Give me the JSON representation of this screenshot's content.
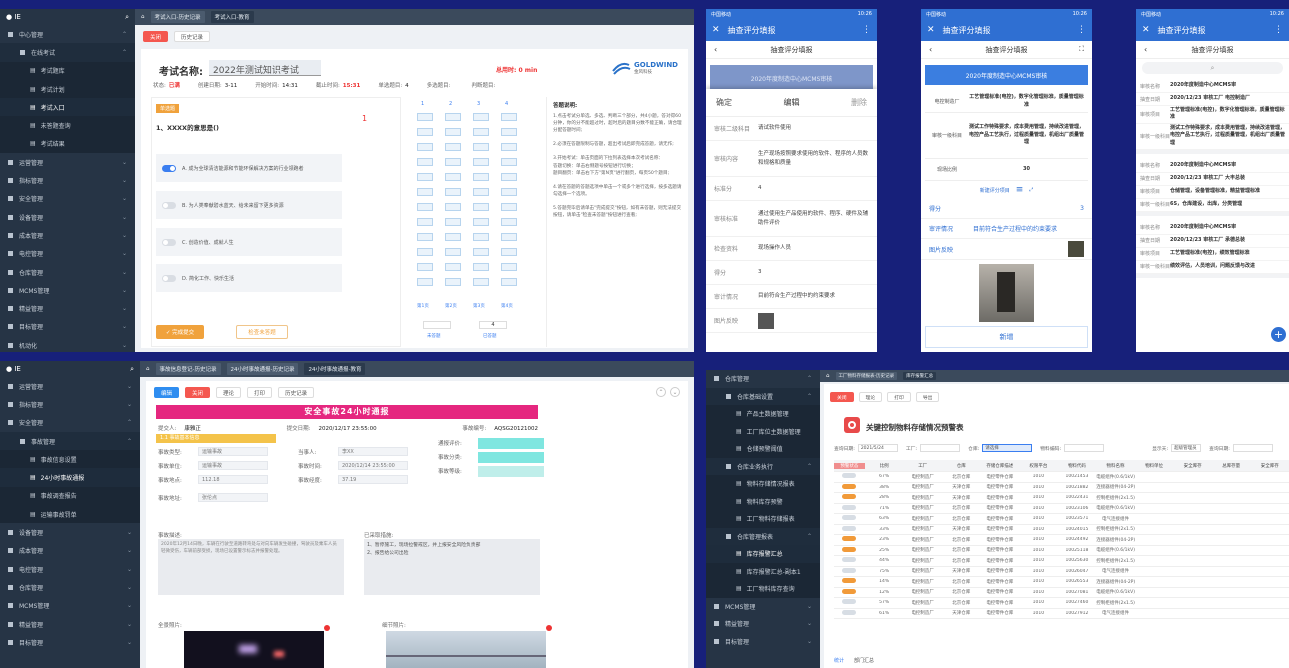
{
  "logo": "● IE",
  "p1": {
    "tabs": [
      "考试入口-历史记录",
      "考试入口-教育"
    ],
    "sidebar": [
      {
        "label": "中心管理",
        "level": 0,
        "open": true
      },
      {
        "label": "在线考试",
        "level": 1,
        "open": true
      },
      {
        "label": "考试题库",
        "level": 2
      },
      {
        "label": "考试计划",
        "level": 2
      },
      {
        "label": "考试入口",
        "level": 2,
        "active": true
      },
      {
        "label": "未答题查询",
        "level": 2
      },
      {
        "label": "考试结果",
        "level": 2
      },
      {
        "label": "运营管理",
        "level": 0
      },
      {
        "label": "指标管理",
        "level": 0
      },
      {
        "label": "安全管理",
        "level": 0
      },
      {
        "label": "设备管理",
        "level": 0
      },
      {
        "label": "成本管理",
        "level": 0
      },
      {
        "label": "电控管理",
        "level": 0
      },
      {
        "label": "仓库管理",
        "level": 0
      },
      {
        "label": "MCMS管理",
        "level": 0
      },
      {
        "label": "精益管理",
        "level": 0
      },
      {
        "label": "目标管理",
        "level": 0
      },
      {
        "label": "机动化",
        "level": 0
      }
    ],
    "buttons": {
      "close": "关闭",
      "history": "历史记录",
      "submit": "✓ 完成提交",
      "next": "检查未答题"
    },
    "exam_label": "考试名称:",
    "exam_name": "2022年测试知识考试",
    "timer_label": "总用时:",
    "timer_value": "0 min",
    "brand": "GOLDWIND",
    "brand_sub": "金风科技",
    "info": [
      {
        "k": "状态:",
        "v": "已满"
      },
      {
        "k": "创建日期:",
        "v": "3-11"
      },
      {
        "k": "开始时间:",
        "v": "14:31"
      },
      {
        "k": "截止时间:",
        "v": "15:31"
      },
      {
        "k": "单选题目:",
        "v": "4"
      },
      {
        "k": "多选题目:",
        "v": ""
      },
      {
        "k": "判断题目:",
        "v": ""
      }
    ],
    "qtag": "单选题",
    "question": "1、XXXX的意思是()",
    "score": "1",
    "options": [
      "A. 成为全球清洁能源和节能环保解决方案的行业领跑者",
      "B. 为人类奉献碧水蓝天、给未来留下更多资源",
      "C. 创造价值、成就人生",
      "D. 简化工作、快乐生活"
    ],
    "grid_cols": [
      "1",
      "2",
      "3",
      "4"
    ],
    "grid_pages": [
      "第1页",
      "第2页",
      "第3页",
      "第4页"
    ],
    "pager_labels": [
      "未答题",
      "已答题"
    ],
    "pager_value": "4",
    "notes_title": "答题说明:",
    "notes": [
      "1.点击考试分单选、多选、判断三个部分，共4小题，答对得60分钟，你的分不能超过时，超时后的题目分数不能正确，请合理分配答题时间;",
      "2.必须在答题限制与答题，超出考试后即完成答题，请无作;",
      "3.开始考试：单击页面的下拉列表选择本次考试名称：\n答题切换：单击右侧题号按钮进行切换；\n题目翻页：单击右下方\"第N页\"进行翻页，每页50个题目;",
      "4.请在答题的答题选项中单击一个或多个进行选择，按多选题请勾选择一个选项。",
      "5.答题完毕后请单击\"完成提交\"按钮，如有未答题，则无法提交按钮，请单击\"检查未答题\"按钮进行查看;"
    ]
  },
  "phone1": {
    "status": "中国移动",
    "status_right": "10:26",
    "title": "抽查评分填报",
    "subtitle": "抽查评分填报",
    "banner": "2020年度制造中心MCMS审核",
    "sheet_actions": [
      "确定",
      "编辑",
      "删除"
    ],
    "rows": [
      {
        "k": "审核二级科目",
        "v": "请试软件使用"
      },
      {
        "k": "审核内容",
        "v": "生产现场按照要求使用的软件、程序的人员数和规格和质量"
      },
      {
        "k": "标准分",
        "v": "4"
      },
      {
        "k": "审核标准",
        "v": "通过使用生产品使用的软件、程序、硬件及辅助件评价"
      },
      {
        "k": "检查资料",
        "v": "现场操作人员"
      },
      {
        "k": "得分",
        "v": "3"
      },
      {
        "k": "审计情况",
        "v": "目前符合生产过程中的约束要求"
      },
      {
        "k": "图片反映",
        "v": ""
      }
    ]
  },
  "phone2": {
    "status": "中国移动",
    "status_right": "10:26",
    "title": "抽查评分填报",
    "subtitle": "抽查评分填报",
    "banner": "2020年度制造中心MCMS审核",
    "rows": [
      {
        "k": "电控制造厂",
        "v": "工艺管理标准(电控)，数字化管理标准，质量管理标准"
      },
      {
        "k": "审核一级科目",
        "v": "测试工作特殊要求，成本费用管理，持续改进管理，电控产品工艺执行，过程质量管理，机组出厂质量管理"
      },
      {
        "k": "现场比例",
        "v": "30"
      }
    ],
    "add_label": "新建评分项目",
    "score_k": "得分",
    "score_v": "3",
    "audit_k": "审评情况",
    "audit_v": "目前符合生产过程中的约束要求",
    "photo_k": "图片反映",
    "confirm": "新增"
  },
  "phone3": {
    "status": "中国移动",
    "status_right": "10:26",
    "title": "抽查评分填报",
    "subtitle": "抽查评分填报",
    "cards": [
      [
        {
          "k": "审核名称",
          "v": "2020年度制造中心MCMS审"
        },
        {
          "k": "抽查日期",
          "v": "2020/12/23 审核工厂  电控制造厂"
        },
        {
          "k": "审核项目",
          "v": "工艺管理标准(电控)，数字化管理标准，质量管理标准"
        },
        {
          "k": "审核一级科目",
          "v": "测试工作特殊要求，成本费用管理，持续改进管理，电控产品工艺执行，过程质量管理，机组出厂质量管理"
        }
      ],
      [
        {
          "k": "审核名称",
          "v": "2020年度制造中心MCMS审"
        },
        {
          "k": "抽查日期",
          "v": "2020/12/23 审核工厂  大丰总装"
        },
        {
          "k": "审核项目",
          "v": "仓储管理，设备管理标准，精益管理标准"
        },
        {
          "k": "审核一级科目",
          "v": "6S，仓库建设，出库，分类管理"
        }
      ],
      [
        {
          "k": "审核名称",
          "v": "2020年度制造中心MCMS审"
        },
        {
          "k": "抽查日期",
          "v": "2020/12/23 审核工厂  承德总装"
        },
        {
          "k": "审核项目",
          "v": "工艺管理标准(电控)，绩效管理标准"
        },
        {
          "k": "审核一级科目",
          "v": "绩效评估，人员培训，问题反馈与改进"
        }
      ]
    ]
  },
  "p4": {
    "tabs": [
      "事故信息登记-历史记录",
      "24小时事故通报-历史记录",
      "24小时事故通报-教育"
    ],
    "sidebar": [
      {
        "label": "运营管理",
        "level": 0
      },
      {
        "label": "指标管理",
        "level": 0
      },
      {
        "label": "安全管理",
        "level": 0,
        "open": true
      },
      {
        "label": "事故管理",
        "level": 1,
        "open": true
      },
      {
        "label": "事故信息设置",
        "level": 2
      },
      {
        "label": "24小时事故通报",
        "level": 2,
        "active": true
      },
      {
        "label": "事故调查报告",
        "level": 2
      },
      {
        "label": "运输事故罚单",
        "level": 2
      },
      {
        "label": "设备管理",
        "level": 0
      },
      {
        "label": "成本管理",
        "level": 0
      },
      {
        "label": "电控管理",
        "level": 0
      },
      {
        "label": "仓库管理",
        "level": 0
      },
      {
        "label": "MCMS管理",
        "level": 0
      },
      {
        "label": "精益管理",
        "level": 0
      },
      {
        "label": "目标管理",
        "level": 0
      }
    ],
    "buttons": [
      "编辑",
      "关闭",
      "理论",
      "打印",
      "历史记录"
    ],
    "title": "安全事故24小时通报",
    "meta": [
      {
        "k": "提交人:",
        "v": "康雅正"
      },
      {
        "k": "提交日期:",
        "v": "2020/12/17 23:55:00"
      },
      {
        "k": "事故编号:",
        "v": "AQSG20121002"
      }
    ],
    "section": "1.1 事故基本信息",
    "fields": [
      {
        "k": "事故类型:",
        "v": "运输事故"
      },
      {
        "k": "当事人:",
        "v": "李XX"
      },
      {
        "k": "事故单位:",
        "v": "运输事故"
      },
      {
        "k": "事故时间:",
        "v": "2020/12/14 23:55:00"
      },
      {
        "k": "事故地点:",
        "v": "112.18"
      },
      {
        "k": "事故经度:",
        "v": "37.19"
      },
      {
        "k": "事故地址:",
        "v": "张伦点"
      }
    ],
    "right_labels": [
      "通报评价:",
      "事故分类:",
      "事故等级:"
    ],
    "desc_label": "事故描述:",
    "desc_text": "2020年12月14日晚，车辆在行驶至道路转弯处与对向车辆发生碰撞，驾驶员及乘车人员轻微受伤，车辆前部受损，现场已设置警示标志并报警处理。",
    "action_label": "已采取措施:",
    "actions": [
      "1、暂停施工，现场拉警戒区，并上报安全风险负责部",
      "2、报告给公司出险"
    ],
    "photo1_label": "全景照片:",
    "photo2_label": "细节照片:"
  },
  "p5": {
    "tabs": [
      "工厂物料存储报表-历史记录",
      "库存报警汇总"
    ],
    "sidebar": [
      {
        "label": "仓库管理",
        "level": 0,
        "open": true
      },
      {
        "label": "仓库基础设置",
        "level": 1,
        "open": true
      },
      {
        "label": "产品主数据管理",
        "level": 2
      },
      {
        "label": "工厂库位主数据管理",
        "level": 2
      },
      {
        "label": "仓储预警阈值",
        "level": 2
      },
      {
        "label": "仓库业务执行",
        "level": 1,
        "open": true
      },
      {
        "label": "物料存储情况报表",
        "level": 2
      },
      {
        "label": "物料库存预警",
        "level": 2
      },
      {
        "label": "工厂物料存储报表",
        "level": 2
      },
      {
        "label": "仓库管理报表",
        "level": 1,
        "open": true
      },
      {
        "label": "库存报警汇总",
        "level": 2,
        "active": true
      },
      {
        "label": "库存报警汇总-副本1",
        "level": 2
      },
      {
        "label": "工厂物料库存查询",
        "level": 2
      },
      {
        "label": "MCMS管理",
        "level": 0
      },
      {
        "label": "精益管理",
        "level": 0
      },
      {
        "label": "目标管理",
        "level": 0
      }
    ],
    "buttons": [
      "关闭",
      "理论",
      "打印",
      "导出"
    ],
    "report_title": "关键控制物料存储情况预警表",
    "filters": [
      {
        "k": "查询日期:",
        "v": "2021/5/24"
      },
      {
        "k": "工厂:",
        "v": ""
      },
      {
        "k": "仓库:",
        "v": "请选择"
      },
      {
        "k": "物料编码:",
        "v": ""
      },
      {
        "k": "显示天:",
        "v": "超级管理员"
      },
      {
        "k": "查询日期:",
        "v": ""
      }
    ],
    "columns": [
      "预警状态",
      "比例",
      "工厂",
      "仓库",
      "存储仓库描述",
      "权限平台",
      "物料代码",
      "物料名称",
      "物料单位",
      "安全库存",
      "总库存量",
      "安全库存"
    ],
    "rows": [
      {
        "flag": false,
        "cells": [
          "67%",
          "电控制造厂",
          "北京仓库",
          "电控零件仓库",
          "1010",
          "10021453",
          "电缆组件(0.6/1kV)"
        ]
      },
      {
        "flag": true,
        "cells": [
          "38%",
          "电控制造厂",
          "天津仓库",
          "电控零件仓库",
          "1010",
          "10021882",
          "连接器组件(04-2P)"
        ]
      },
      {
        "flag": true,
        "cells": [
          "28%",
          "电控制造厂",
          "天津仓库",
          "电控零件仓库",
          "1010",
          "10022431",
          "控制柜组件(2x1.5)"
        ]
      },
      {
        "flag": false,
        "cells": [
          "71%",
          "电控制造厂",
          "北京仓库",
          "电控零件仓库",
          "1010",
          "10023106",
          "电缆组件(0.6/1kV)"
        ]
      },
      {
        "flag": false,
        "cells": [
          "63%",
          "电控制造厂",
          "北京仓库",
          "电控零件仓库",
          "1010",
          "10023571",
          "电气连接组件"
        ]
      },
      {
        "flag": false,
        "cells": [
          "33%",
          "电控制造厂",
          "天津仓库",
          "电控零件仓库",
          "1010",
          "10024015",
          "控制柜组件(2x1.5)"
        ]
      },
      {
        "flag": true,
        "cells": [
          "23%",
          "电控制造厂",
          "北京仓库",
          "电控零件仓库",
          "1010",
          "10024492",
          "连接器组件(04-2P)"
        ]
      },
      {
        "flag": true,
        "cells": [
          "25%",
          "电控制造厂",
          "北京仓库",
          "电控零件仓库",
          "1010",
          "10025118",
          "电缆组件(0.6/1kV)"
        ]
      },
      {
        "flag": false,
        "cells": [
          "44%",
          "电控制造厂",
          "北京仓库",
          "电控零件仓库",
          "1010",
          "10025630",
          "控制柜组件(2x1.5)"
        ]
      },
      {
        "flag": false,
        "cells": [
          "75%",
          "电控制造厂",
          "天津仓库",
          "电控零件仓库",
          "1010",
          "10026047",
          "电气连接组件"
        ]
      },
      {
        "flag": true,
        "cells": [
          "14%",
          "电控制造厂",
          "北京仓库",
          "电控零件仓库",
          "1010",
          "10026553",
          "连接器组件(04-2P)"
        ]
      },
      {
        "flag": true,
        "cells": [
          "12%",
          "电控制造厂",
          "北京仓库",
          "电控零件仓库",
          "1010",
          "10027081",
          "电缆组件(0.6/1kV)"
        ]
      },
      {
        "flag": false,
        "cells": [
          "57%",
          "电控制造厂",
          "北京仓库",
          "电控零件仓库",
          "1010",
          "10027460",
          "控制柜组件(2x1.5)"
        ]
      },
      {
        "flag": false,
        "cells": [
          "61%",
          "电控制造厂",
          "天津仓库",
          "电控零件仓库",
          "1010",
          "10027912",
          "电气连接组件"
        ]
      }
    ],
    "footer_tabs": [
      "统计",
      "部门汇总"
    ]
  }
}
